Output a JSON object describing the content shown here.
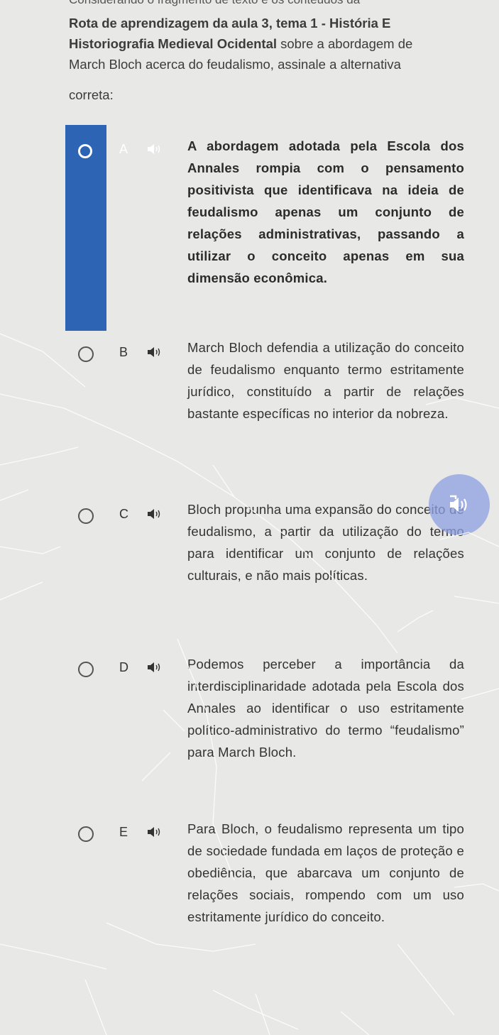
{
  "question": {
    "line0": "Considerando o fragmento de texto e os conteúdos da",
    "line1": "Rota de aprendizagem da aula 3, tema 1 - História E",
    "line2": "Historiografia Medieval Ocidental",
    "line2_rest": " sobre a abordagem de",
    "line3": "March Bloch acerca do feudalismo, assinale a alternativa",
    "line4": "correta:"
  },
  "options": [
    {
      "letter": "A",
      "selected": true,
      "text": "A abordagem adotada pela Escola dos Annales rompia com o pensamento positivista que identificava na ideia de feudalismo apenas um conjunto de relações administrativas, passando a utilizar o conceito apenas em sua dimensão econômica."
    },
    {
      "letter": "B",
      "selected": false,
      "text": "March Bloch defendia a utilização do conceito de feudalismo enquanto termo estritamente jurídico, constituído a partir de relações bastante específicas no interior da nobreza."
    },
    {
      "letter": "C",
      "selected": false,
      "text": "Bloch propunha uma expansão do conceito de feudalismo, a partir da utilização do termo para identificar um conjunto de relações culturais, e não mais políticas."
    },
    {
      "letter": "D",
      "selected": false,
      "text": "Podemos perceber a importância da interdisciplinaridade adotada pela Escola dos Annales ao identificar o uso estritamente político-administrativo do termo “feudalismo” para March Bloch."
    },
    {
      "letter": "E",
      "selected": false,
      "text": "Para Bloch, o feudalismo representa um tipo de sociedade fundada em laços de proteção e obediência, que abarcava um conjunto de relações sociais, rompendo com um uso estritamente jurídico do conceito."
    }
  ],
  "icons": {
    "speaker": "speaker-icon",
    "float_button": "text-to-speech-icon"
  },
  "colors": {
    "selected_bar": "#2d64b4",
    "float_button": "#8ca0e1",
    "background": "#e8e8e6"
  }
}
